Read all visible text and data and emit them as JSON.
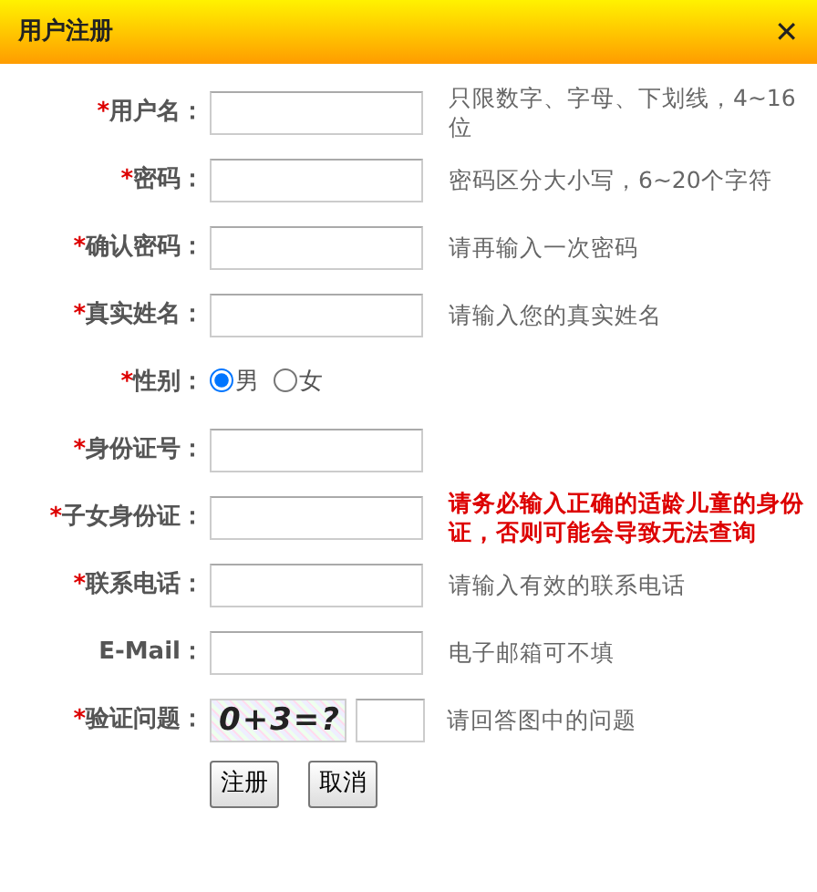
{
  "window": {
    "title": "用户注册",
    "close": "✕"
  },
  "fields": [
    {
      "kind": "text",
      "marker": "*",
      "label": "用户名：",
      "hint": "只限数字、字母、下划线，4~16位",
      "warning": false
    },
    {
      "kind": "text",
      "marker": "*",
      "label": "密码：",
      "hint": "密码区分大小写，6~20个字符",
      "warning": false
    },
    {
      "kind": "text",
      "marker": "*",
      "label": "确认密码：",
      "hint": "请再输入一次密码",
      "warning": false
    },
    {
      "kind": "text",
      "marker": "*",
      "label": "真实姓名：",
      "hint": "请输入您的真实姓名",
      "warning": false
    },
    {
      "kind": "radio",
      "marker": "*",
      "label": "性别：",
      "options": [
        {
          "label": "男",
          "selected": true
        },
        {
          "label": "女",
          "selected": false
        }
      ]
    },
    {
      "kind": "text",
      "marker": "*",
      "label": "身份证号："
    },
    {
      "kind": "text",
      "marker": "*",
      "label": "子女身份证：",
      "hint": "请务必输入正确的适龄儿童的身份证，否则可能会导致无法查询",
      "warning": true
    },
    {
      "kind": "text",
      "marker": "*",
      "label": "联系电话：",
      "hint": "请输入有效的联系电话",
      "warning": false
    },
    {
      "kind": "text",
      "label": "E-Mail：",
      "hint": "电子邮箱可不填",
      "warning": false
    },
    {
      "kind": "captcha",
      "marker": "*",
      "label": "验证问题：",
      "captcha": "0+3=?",
      "hint": "请回答图中的问题",
      "warning": false
    }
  ],
  "buttons": [
    "注册",
    "取消"
  ]
}
